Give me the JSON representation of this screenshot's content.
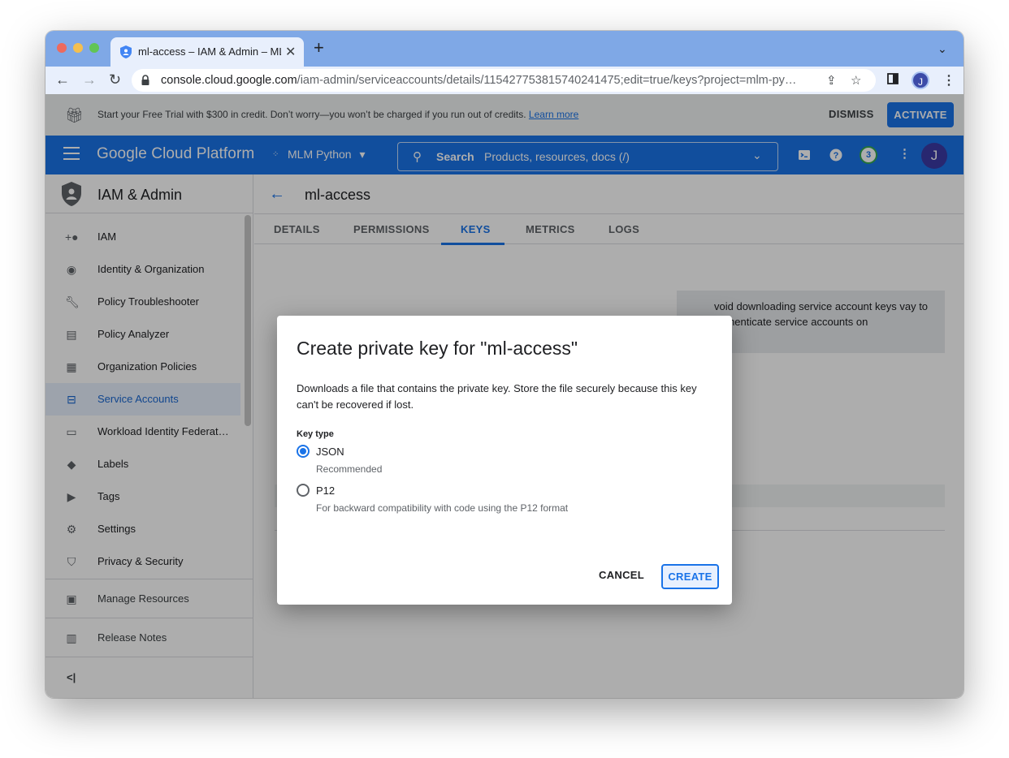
{
  "browser": {
    "tab_title": "ml-access – IAM & Admin – ML",
    "tab_close": "✕",
    "new_tab": "+",
    "url_host": "console.cloud.google.com",
    "url_path": "/iam-admin/serviceaccounts/details/115427753815740241475;edit=true/keys?project=mlm-py…",
    "profile_initial": "J"
  },
  "promo": {
    "text": "Start your Free Trial with $300 in credit. Don’t worry—you won’t be charged if you run out of credits.",
    "link": "Learn more",
    "dismiss": "DISMISS",
    "activate": "ACTIVATE"
  },
  "header": {
    "title": "Google Cloud Platform",
    "project": "MLM Python",
    "search_label": "Search",
    "search_placeholder": "Products, resources, docs (/)",
    "notifications_count": "3",
    "avatar_initial": "J"
  },
  "sidebar": {
    "title": "IAM & Admin",
    "items": [
      {
        "label": "IAM",
        "icon": "person-add-icon"
      },
      {
        "label": "Identity & Organization",
        "icon": "account-circle-icon"
      },
      {
        "label": "Policy Troubleshooter",
        "icon": "wrench-icon"
      },
      {
        "label": "Policy Analyzer",
        "icon": "policy-doc-icon"
      },
      {
        "label": "Organization Policies",
        "icon": "list-doc-icon"
      },
      {
        "label": "Service Accounts",
        "icon": "service-account-icon"
      },
      {
        "label": "Workload Identity Federat…",
        "icon": "id-card-icon"
      },
      {
        "label": "Labels",
        "icon": "label-icon"
      },
      {
        "label": "Tags",
        "icon": "tag-icon"
      },
      {
        "label": "Settings",
        "icon": "gear-icon"
      },
      {
        "label": "Privacy & Security",
        "icon": "shield-icon"
      }
    ],
    "manage_resources": "Manage Resources",
    "release_notes": "Release Notes",
    "collapse": "<|"
  },
  "main": {
    "title": "ml-access",
    "tabs": [
      "DETAILS",
      "PERMISSIONS",
      "KEYS",
      "METRICS",
      "LOGS"
    ],
    "active_tab": "KEYS",
    "info_text": "void downloading service account keys vay to authenticate service accounts on"
  },
  "dialog": {
    "title": "Create private key for \"ml-access\"",
    "description": "Downloads a file that contains the private key. Store the file securely because this key can't be recovered if lost.",
    "key_type_label": "Key type",
    "options": [
      {
        "label": "JSON",
        "sub": "Recommended",
        "selected": true
      },
      {
        "label": "P12",
        "sub": "For backward compatibility with code using the P12 format",
        "selected": false
      }
    ],
    "cancel": "CANCEL",
    "create": "CREATE"
  }
}
